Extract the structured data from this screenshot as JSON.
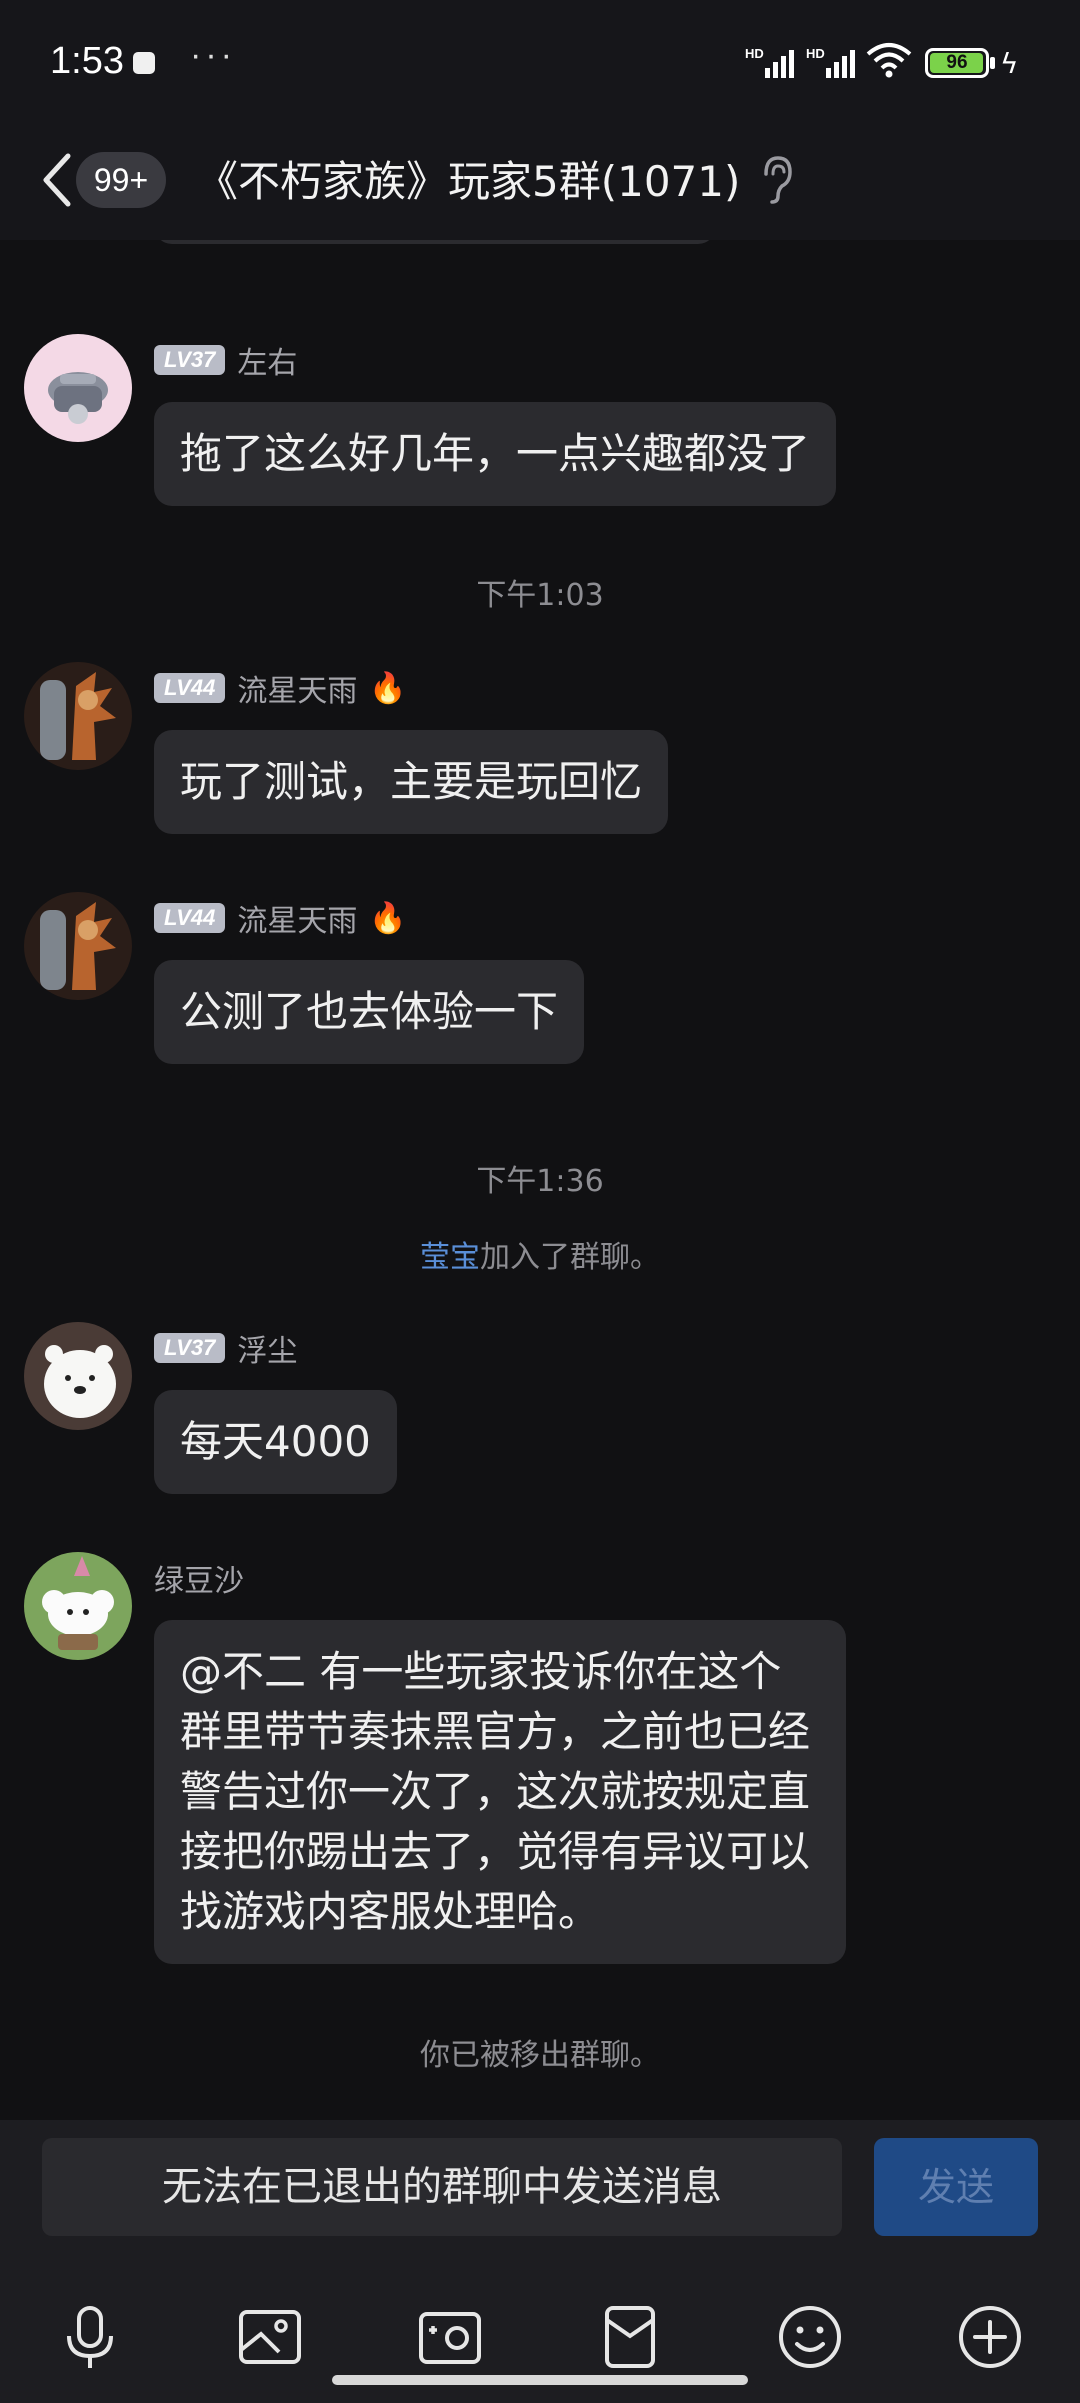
{
  "status_bar": {
    "time": "1:53",
    "signal1_label": "HD",
    "signal2_label": "HD",
    "battery": "96",
    "icons": [
      "download-icon",
      "more-dots-icon",
      "signal-icon",
      "wifi-icon",
      "battery-icon",
      "charging-bolt-icon"
    ]
  },
  "header": {
    "unread_count": "99+",
    "title": "《不朽家族》玩家5群(1071)"
  },
  "messages": [
    {
      "type": "chat",
      "level": "LV37",
      "nickname": "左右",
      "text": "拖了这么好几年，一点兴趣都没了"
    },
    {
      "type": "time",
      "text": "下午1:03"
    },
    {
      "type": "chat",
      "level": "LV44",
      "nickname": "流星天雨",
      "badge_icon": "🔥",
      "text": "玩了测试，主要是玩回忆"
    },
    {
      "type": "chat",
      "level": "LV44",
      "nickname": "流星天雨",
      "badge_icon": "🔥",
      "text": "公测了也去体验一下"
    },
    {
      "type": "time",
      "text": "下午1:36"
    },
    {
      "type": "system",
      "name": "莹宝",
      "text": "加入了群聊。"
    },
    {
      "type": "chat",
      "level": "LV37",
      "nickname": "浮尘",
      "text": "每天4000"
    },
    {
      "type": "chat",
      "nickname": "绿豆沙",
      "text": "@不二 有一些玩家投诉你在这个群里带节奏抹黑官方，之前也已经警告过你一次了，这次就按规定直接把你踢出去了，觉得有异议可以找游戏内客服处理哈。"
    },
    {
      "type": "system",
      "text": "你已被移出群聊。"
    }
  ],
  "input_bar": {
    "placeholder": "无法在已退出的群聊中发送消息",
    "send_label": "发送",
    "tools": [
      "microphone-icon",
      "image-icon",
      "camera-icon",
      "red-packet-icon",
      "emoji-icon",
      "plus-icon"
    ]
  },
  "colors": {
    "background": "#111113",
    "bubble": "#2b2b2f",
    "link": "#5a8fd8",
    "send_button": "#1f4a86",
    "battery_fill": "#7bd24a"
  }
}
